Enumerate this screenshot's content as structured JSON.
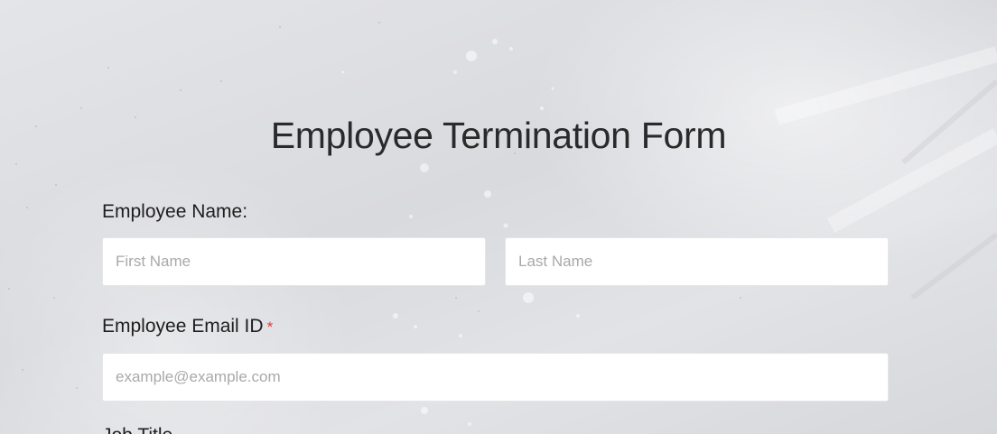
{
  "form": {
    "title": "Employee Termination Form",
    "employee_name": {
      "label": "Employee Name:",
      "first_placeholder": "First Name",
      "last_placeholder": "Last Name"
    },
    "email": {
      "label": "Employee Email ID",
      "required_mark": "*",
      "placeholder": "example@example.com"
    },
    "next_field_label": "Job Title"
  },
  "colors": {
    "required": "#e4393c",
    "text": "#1e1e1e",
    "placeholder": "#a9a9ab"
  }
}
